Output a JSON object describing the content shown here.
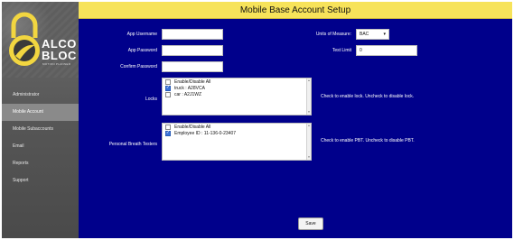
{
  "app": {
    "logo_line1": "ALCO",
    "logo_line2": "BLOC",
    "logo_tagline": "MOTION PLANNER"
  },
  "sidebar": {
    "items": [
      {
        "label": "Administrator",
        "active": false
      },
      {
        "label": "Mobile Account",
        "active": true
      },
      {
        "label": "Mobile Subaccounts",
        "active": false
      },
      {
        "label": "Email",
        "active": false
      },
      {
        "label": "Reports",
        "active": false
      },
      {
        "label": "Support",
        "active": false
      }
    ]
  },
  "header": {
    "title": "Mobile Base Account Setup"
  },
  "form": {
    "app_username_label": "App Username",
    "app_username_value": "",
    "app_password_label": "App Password",
    "app_password_value": "",
    "confirm_password_label": "Confirm Password",
    "confirm_password_value": "",
    "units_label": "Units of Measure:",
    "units_value": "BAC",
    "test_limit_label": "Test Limit",
    "test_limit_value": "0",
    "locks_label": "Locks",
    "locks_items": [
      {
        "label": "Enable/Disable All",
        "checked": false
      },
      {
        "label": "truck : A28VCA",
        "checked": true
      },
      {
        "label": "car : A2J1WZ",
        "checked": false
      }
    ],
    "locks_help": "Check to enable lock. Uncheck to disable lock.",
    "pbt_label": "Personal Breath Testers",
    "pbt_items": [
      {
        "label": "Enable/Disable All",
        "checked": false
      },
      {
        "label": "Employee ID : 11-136-0-23407",
        "checked": true
      }
    ],
    "pbt_help": "Check to enable PBT. Uncheck to disable PBT.",
    "save_label": "Save"
  },
  "colors": {
    "main_bg": "#00008b",
    "title_bar": "#f7e35a",
    "sidebar_bg": "#5a5a5a",
    "logo_accent": "#f2d640",
    "checkbox_checked": "#3b73d9"
  },
  "icons": {
    "logo": "padlock-logo-icon",
    "dropdown": "chevron-down-icon",
    "checkmark": "check-icon"
  }
}
